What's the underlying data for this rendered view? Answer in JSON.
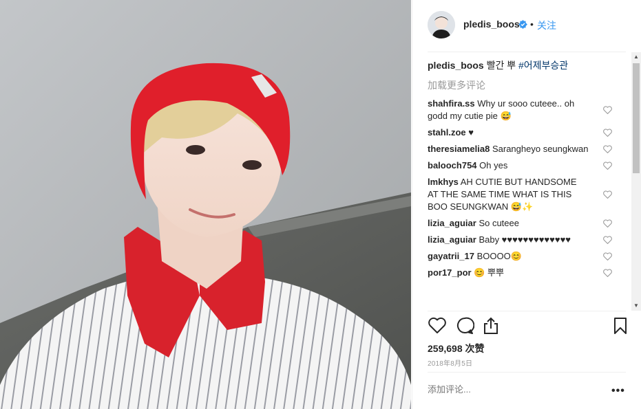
{
  "post": {
    "author": "pledis_boos",
    "follow_label": "关注",
    "dot": "•",
    "caption_text": "빨간 뿌",
    "caption_hashtag": "#어제부승관",
    "load_more": "加载更多评论",
    "likes": "259,698 次赞",
    "date": "2018年8月5日",
    "add_comment_placeholder": "添加评论...",
    "more": "•••",
    "icons": {
      "verified": "verified-badge-icon",
      "like": "heart-icon",
      "comment": "comment-icon",
      "share": "share-icon",
      "save": "bookmark-icon",
      "options": "more-options-icon"
    },
    "colors": {
      "accent": "#3897f0",
      "text": "#262626",
      "muted": "#999999",
      "hashtag": "#003569",
      "beret": "#e01f2b"
    }
  },
  "comments": [
    {
      "user": "shahfira.ss",
      "text": "Why ur sooo cuteee.. oh godd my cutie pie 😅"
    },
    {
      "user": "stahl.zoe",
      "text": "♥"
    },
    {
      "user": "theresiamelia8",
      "text": "Saranghеyo seungkwan"
    },
    {
      "user": "balooch754",
      "text": "Oh yes"
    },
    {
      "user": "lmkhys",
      "text": "AH CUTIE BUT HANDSOME AT THE SAME TIME WHAT IS THIS BOO SEUNGKWAN 😅✨"
    },
    {
      "user": "lizia_aguiar",
      "text": "So cuteee"
    },
    {
      "user": "lizia_aguiar",
      "text": "Baby ♥♥♥♥♥♥♥♥♥♥♥♥♥"
    },
    {
      "user": "gayatrii_17",
      "text": "BOOOO😊"
    },
    {
      "user": "por17_por",
      "text": "😊 뿌뿌"
    }
  ]
}
